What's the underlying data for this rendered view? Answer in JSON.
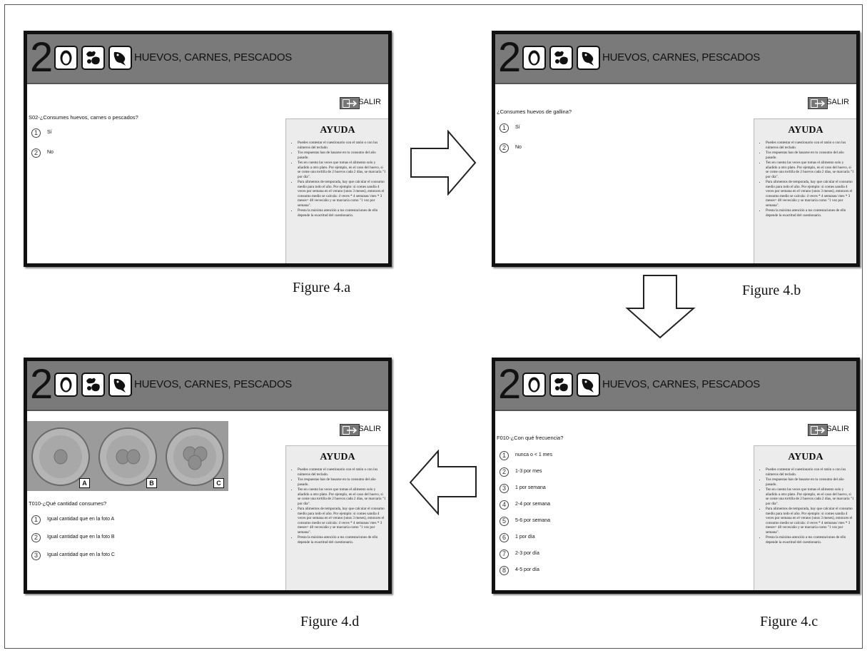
{
  "header": {
    "number": "2",
    "title": "HUEVOS, CARNES, PESCADOS"
  },
  "salir_label": "SALIR",
  "ayuda": {
    "title": "AYUDA",
    "items": [
      "Puedes contestar el cuestionario con el ratón o con los números del teclado.",
      "Tus respuestas han de basarse en tu consumo del año pasado.",
      "Ten en cuenta las veces que tomas el alimento solo y añadido a otro plato. Por ejemplo, en el caso del huevo, si se come una tortilla de 2 huevos cada 2 días, se marcaría \"1 por día\".",
      "Para alimentos de temporada, hay que calcular el consumo medio para todo el año. Por ejemplo: si comes sandía 4 veces por semana en el verano (unos 3 meses), entonces el consumo medio se calcula: 4 veces * 4 semanas/ mes * 3 meses= 48 veces/año y se marcaría como \"1 vez por semana\".",
      "Presta la máxima atención a tus contestaciones de ello depende la exactitud del cuestionario."
    ]
  },
  "screen_a": {
    "question": "S02-¿Consumes huevos, carnes o pescados?",
    "options": [
      {
        "num": "1",
        "label": "Sí"
      },
      {
        "num": "2",
        "label": "No"
      }
    ],
    "caption": "Figure 4.a"
  },
  "screen_b": {
    "question": "¿Consumes huevos de gallina?",
    "options": [
      {
        "num": "1",
        "label": "Sí"
      },
      {
        "num": "2",
        "label": "No"
      }
    ],
    "caption": "Figure 4.b"
  },
  "screen_c": {
    "question": "F010-¿Con qué frecuencia?",
    "options": [
      {
        "num": "1",
        "label": "nunca o < 1 mes"
      },
      {
        "num": "2",
        "label": "1-3 por mes"
      },
      {
        "num": "3",
        "label": "1 por semana"
      },
      {
        "num": "4",
        "label": "2-4 por semana"
      },
      {
        "num": "5",
        "label": "5-6 por semana"
      },
      {
        "num": "6",
        "label": "1 por día"
      },
      {
        "num": "7",
        "label": "2-3 por día"
      },
      {
        "num": "8",
        "label": "4-5 por día"
      }
    ],
    "caption": "Figure 4.c"
  },
  "screen_d": {
    "photo_tags": [
      "A",
      "B",
      "C"
    ],
    "question": "T010-¿Qué cantidad consumes?",
    "options": [
      {
        "num": "1",
        "label": "Igual cantidad que en la foto A"
      },
      {
        "num": "2",
        "label": "Igual cantidad que en la foto B"
      },
      {
        "num": "3",
        "label": "Igual cantidad que en la foto C"
      }
    ],
    "caption": "Figure 4.d"
  },
  "icons": [
    "egg-icon",
    "meat-icon",
    "fish-icon",
    "exit-icon"
  ],
  "colors": {
    "header_bg": "#7a7a7a",
    "ayuda_bg": "#ececec",
    "frame": "#111111"
  }
}
